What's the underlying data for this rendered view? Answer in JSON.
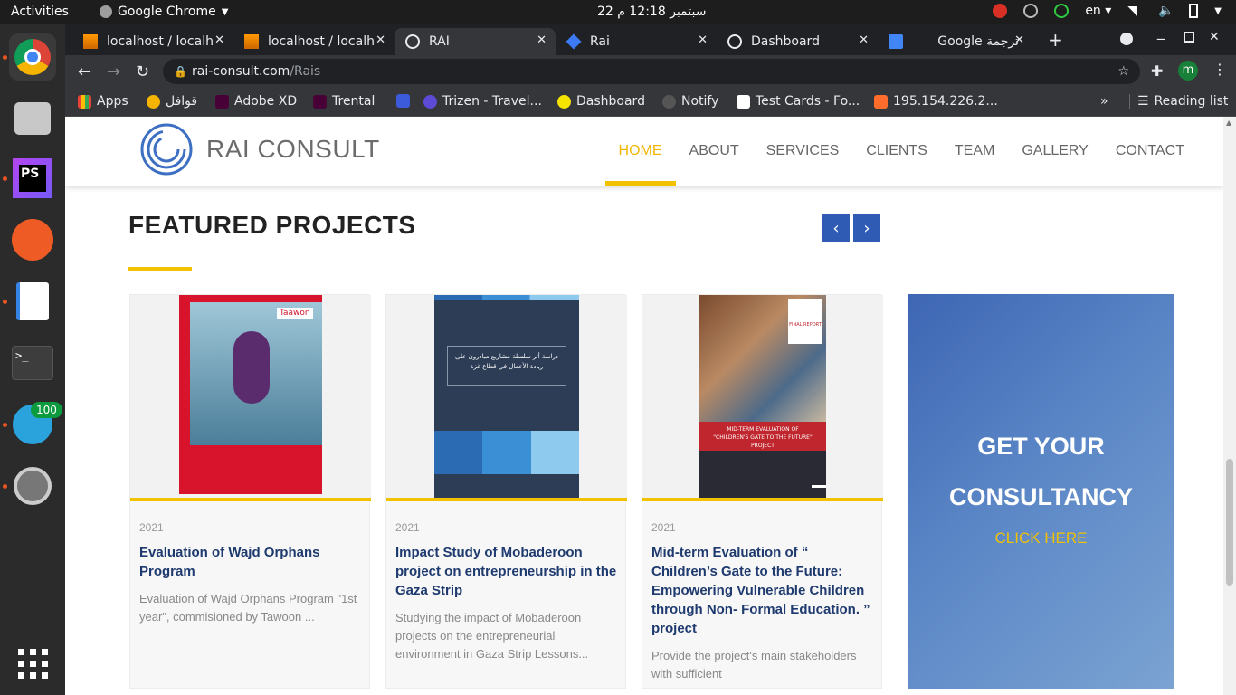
{
  "system": {
    "activities": "Activities",
    "app_menu": "Google Chrome",
    "clock": "22 سبتمبر 12:18 م",
    "lang": "en",
    "telegram_badge": "100"
  },
  "browser": {
    "tabs": [
      {
        "title": "localhost / localh"
      },
      {
        "title": "localhost / localh"
      },
      {
        "title": "RAI"
      },
      {
        "title": "Rai"
      },
      {
        "title": "Dashboard"
      },
      {
        "title": "Google ترجمة"
      }
    ],
    "url_host": "rai-consult.com",
    "url_path": "/Rais",
    "profile_initial": "m",
    "bookmarks": [
      "Apps",
      "قوافل",
      "Adobe XD",
      "Trental",
      "Trizen - Travel...",
      "Dashboard",
      "Notify",
      "Test Cards - Fo...",
      "195.154.226.2..."
    ],
    "reading_list": "Reading list",
    "more_bookmarks": "»"
  },
  "site": {
    "logo_text": "RAI CONSULT",
    "menu": [
      "HOME",
      "ABOUT",
      "SERVICES",
      "CLIENTS",
      "TEAM",
      "GALLERY",
      "CONTACT"
    ],
    "section_title": "FEATURED PROJECTS",
    "prev": "‹",
    "next": "›",
    "projects": [
      {
        "year": "2021",
        "title": "Evaluation of Wajd Orphans Program",
        "desc": "Evaluation of Wajd Orphans Program \"1st year\", commisioned by Tawoon ..."
      },
      {
        "year": "2021",
        "title": "Impact Study of Mobaderoon project on entrepreneurship in the Gaza Strip",
        "desc": " Studying the impact of Mobaderoon projects on the entrepreneurial environment in Gaza Strip Lessons..."
      },
      {
        "year": "2021",
        "title": "Mid-term Evaluation of “ Children’s Gate to the Future: Empowering Vulnerable Children through Non- Formal Education. ” project",
        "desc": "Provide the project's main stakeholders with sufficient"
      }
    ],
    "cta_heading_1": "GET YOUR",
    "cta_heading_2": "CONSULTANCY",
    "cta_link": "CLICK HERE",
    "cover_texts": {
      "tawoon": "Taawon",
      "mobaderoon_title": "دراسة أثر سلسلة مشاريع مبادرون على ريادة الأعمال في قطاع غزة",
      "children_report": "MID-TERM EVALUATION OF \"CHILDREN'S GATE TO THE FUTURE\" PROJECT",
      "final_report": "FINAL REPORT"
    }
  },
  "colors": {
    "accent": "#f2c200",
    "navy": "#1e3a6e",
    "arrow_blue": "#2f5bb5"
  }
}
